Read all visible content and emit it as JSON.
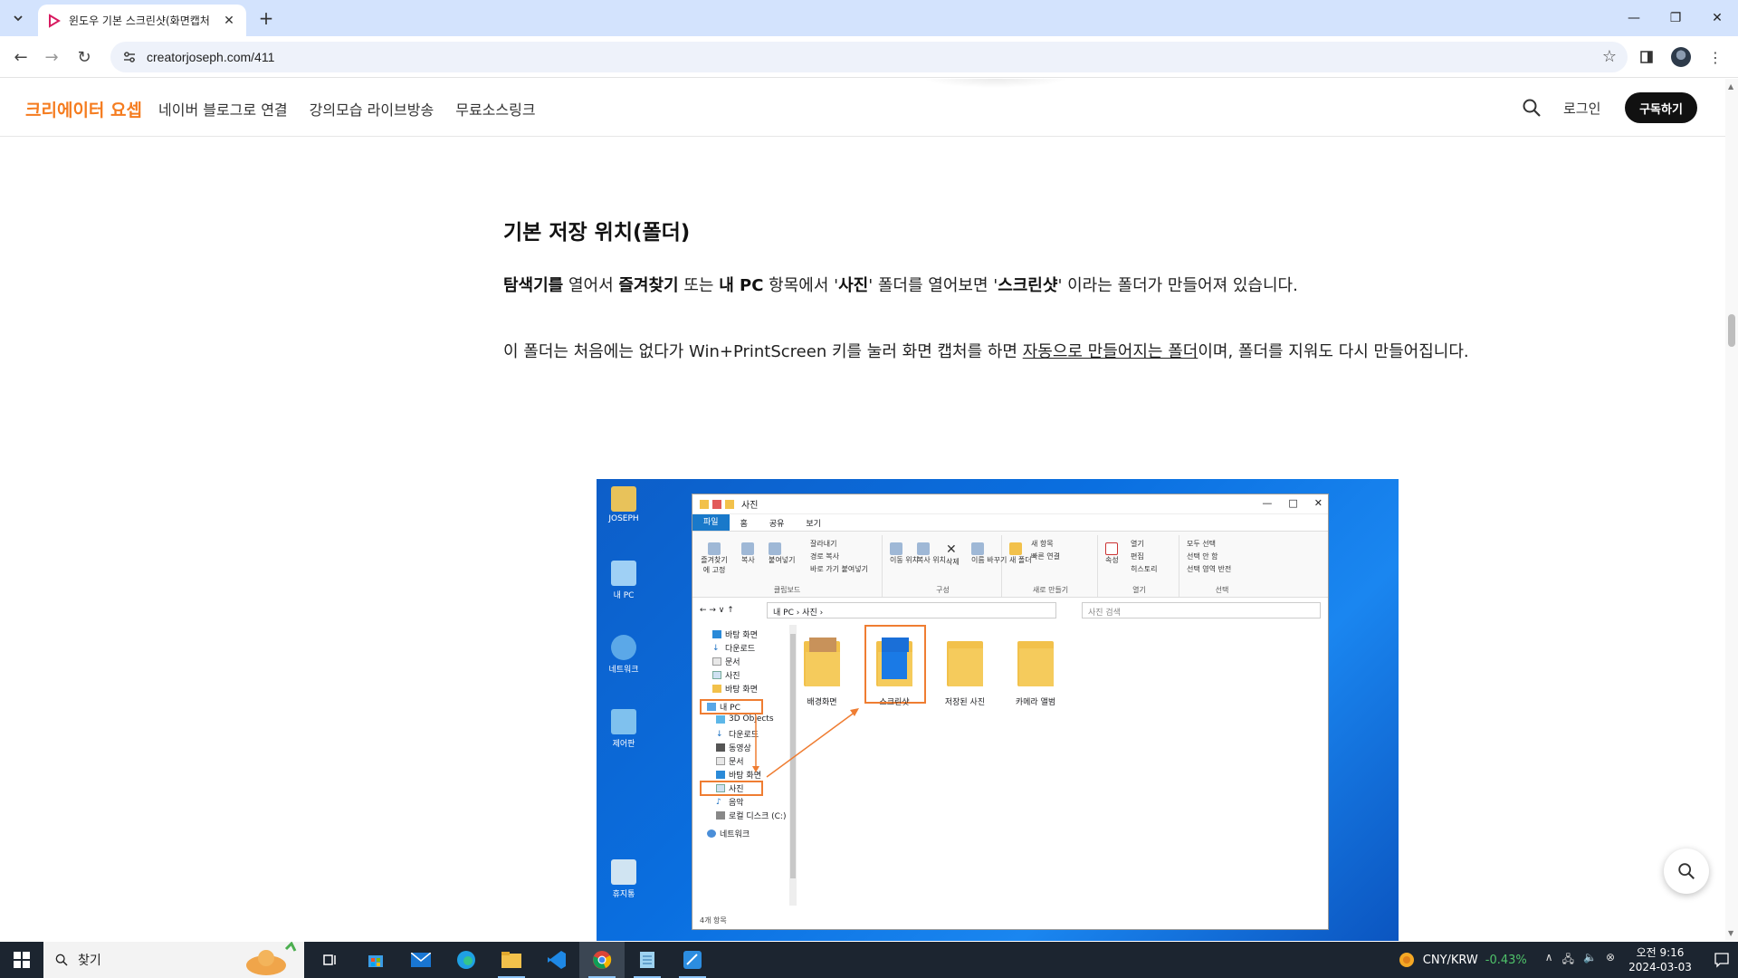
{
  "browser": {
    "tab_title": "윈도우 기본 스크린샷(화면캡처",
    "url": "creatorjoseph.com/411"
  },
  "site": {
    "brand": "크리에이터 요셉",
    "nav": [
      "네이버 블로그로 연결",
      "강의모습 라이브방송",
      "무료소스링크"
    ],
    "login": "로그인",
    "subscribe": "구독하기"
  },
  "article": {
    "heading": "기본 저장 위치(폴더)",
    "p1": {
      "s1": "탐색기를",
      "s2": " 열어서 ",
      "s3": "즐겨찾기",
      "s4": " 또는 ",
      "s5": "내 PC",
      "s6": " 항목에서 '",
      "s7": "사진",
      "s8": "' 폴더를 열어보면 '",
      "s9": "스크린샷",
      "s10": "' 이라는 폴더가 만들어져 있습니다."
    },
    "p2": {
      "s1": "이 폴더는 처음에는 없다가 Win+PrintScreen 키를 눌러 화면 캡처를 하면 ",
      "s2": "자동으로 만들어지는 폴더",
      "s3": "이며, 폴더를 지워도 다시 만들어집니다."
    }
  },
  "screenshot": {
    "desktop_icons": [
      "JOSEPH",
      "내 PC",
      "네트워크",
      "제어판",
      "휴지통"
    ],
    "explorer": {
      "title": "사진",
      "tabs": [
        "파일",
        "홈",
        "공유",
        "보기"
      ],
      "ribbon": {
        "clipboard": {
          "pin": "즐겨찾기에 고정",
          "copy": "복사",
          "paste": "붙여넣기",
          "cut": "잘라내기",
          "copy_path": "경로 복사",
          "paste_shortcut": "바로 가기 붙여넣기",
          "label": "클립보드"
        },
        "organize": {
          "move": "이동 위치",
          "copy_to": "복사 위치",
          "delete": "삭제",
          "rename": "이름 바꾸기",
          "label": "구성"
        },
        "new": {
          "new_folder": "새 폴더",
          "new_item": "새 항목",
          "easy_access": "빠른 연결",
          "label": "새로 만들기"
        },
        "open": {
          "properties": "속성",
          "open": "열기",
          "edit": "편집",
          "history": "히스토리",
          "label": "열기"
        },
        "select": {
          "all": "모두 선택",
          "none": "선택 안 함",
          "invert": "선택 영역 반전",
          "label": "선택"
        }
      },
      "path": "내 PC  ›  사진  ›",
      "search_placeholder": "사진 검색",
      "tree": [
        "바탕 화면",
        "다운로드",
        "문서",
        "사진",
        "바탕 화면",
        "내 PC",
        "3D Objects",
        "다운로드",
        "동영상",
        "문서",
        "바탕 화면",
        "사진",
        "음악",
        "로컬 디스크 (C:)",
        "네트워크"
      ],
      "folders": [
        "배경화면",
        "스크린샷",
        "저장된 사진",
        "카메라 앨범"
      ],
      "status": "4개 항목"
    }
  },
  "taskbar": {
    "search": "찾기",
    "fx_pair": "CNY/KRW",
    "fx_change": "-0.43%",
    "time": "오전 9:16",
    "date": "2024-03-03"
  },
  "colors": {
    "brand": "#f57c1f",
    "highlight": "#ef7d32",
    "tab_strip": "#d3e3fd",
    "taskbar": "#1c2530"
  }
}
